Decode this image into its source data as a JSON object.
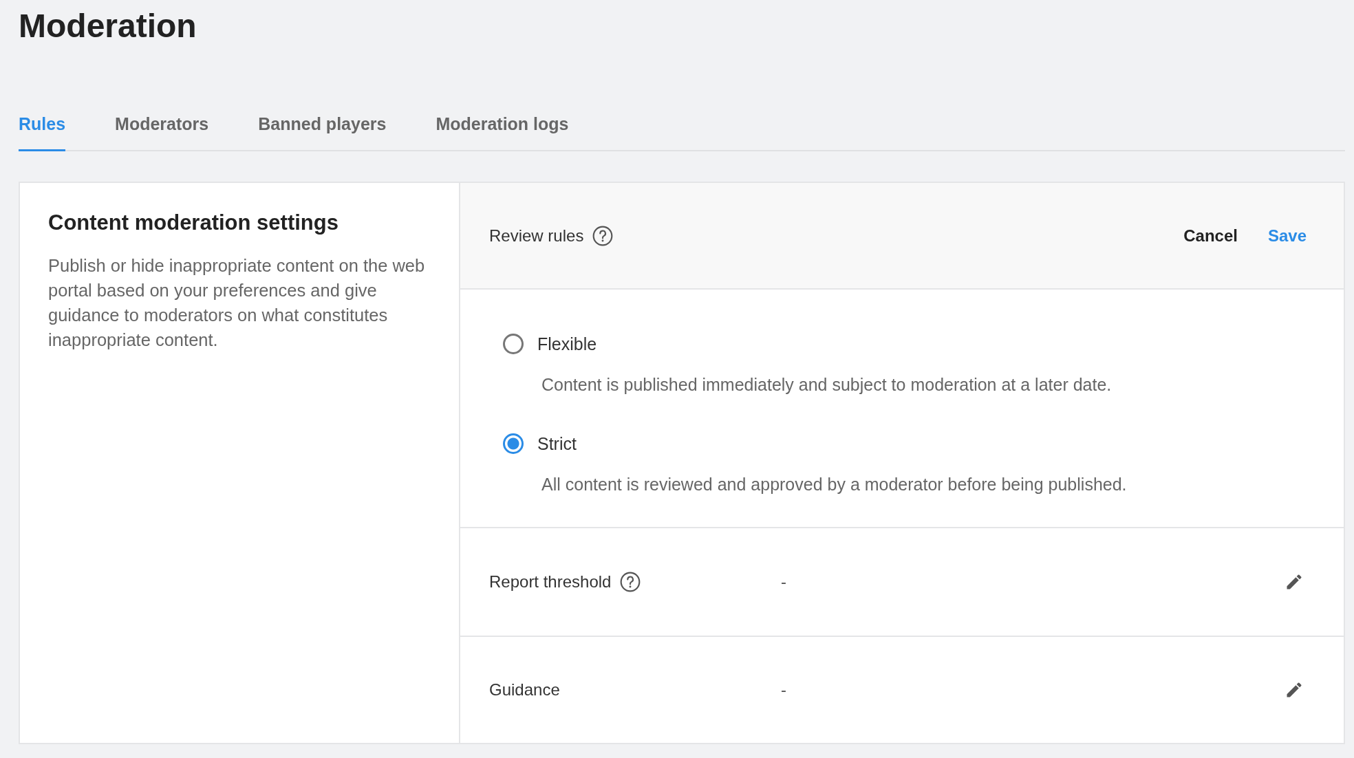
{
  "page": {
    "title": "Moderation"
  },
  "tabs": [
    {
      "label": "Rules",
      "selected": true
    },
    {
      "label": "Moderators",
      "selected": false
    },
    {
      "label": "Banned players",
      "selected": false
    },
    {
      "label": "Moderation logs",
      "selected": false
    }
  ],
  "settings_card": {
    "title": "Content moderation settings",
    "description": "Publish or hide inappropriate content on the web portal based on your preferences and give guidance to moderators on what constitutes inappropriate content."
  },
  "review_rules": {
    "label": "Review rules",
    "cancel": "Cancel",
    "save": "Save",
    "options": [
      {
        "label": "Flexible",
        "description": "Content is published immediately and subject to moderation at a later date.",
        "selected": false
      },
      {
        "label": "Strict",
        "description": "All content is reviewed and approved by a moderator before being published.",
        "selected": true
      }
    ]
  },
  "fields": [
    {
      "label": "Report threshold",
      "help": true,
      "value": "-"
    },
    {
      "label": "Guidance",
      "help": false,
      "value": "-"
    }
  ]
}
